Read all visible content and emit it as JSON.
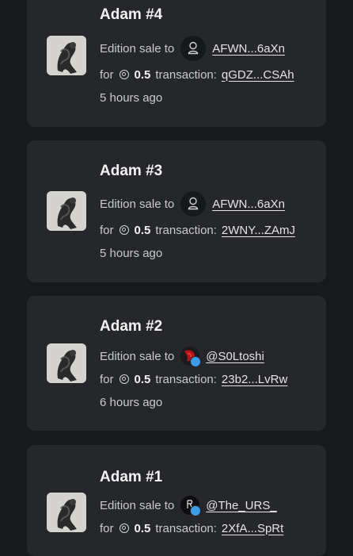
{
  "sales": [
    {
      "title": "Adam #4",
      "label": "Edition sale to",
      "buyer": "AFWN...6aXn",
      "buyer_type": "wallet",
      "for_label": "for",
      "price": "0.5",
      "tx_label": "transaction:",
      "tx": "qGDZ...CSAh",
      "time": "5 hours ago"
    },
    {
      "title": "Adam #3",
      "label": "Edition sale to",
      "buyer": "AFWN...6aXn",
      "buyer_type": "wallet",
      "for_label": "for",
      "price": "0.5",
      "tx_label": "transaction:",
      "tx": "2WNY...ZAmJ",
      "time": "5 hours ago"
    },
    {
      "title": "Adam #2",
      "label": "Edition sale to",
      "buyer": "@S0Ltoshi",
      "buyer_type": "twitter",
      "for_label": "for",
      "price": "0.5",
      "tx_label": "transaction:",
      "tx": "23b2...LvRw",
      "time": "6 hours ago"
    },
    {
      "title": "Adam #1",
      "label": "Edition sale to",
      "buyer": "@The_URS_",
      "buyer_type": "twitter",
      "for_label": "for",
      "price": "0.5",
      "tx_label": "transaction:",
      "tx": "2XfA...SpRt",
      "time": ""
    }
  ],
  "icons": {
    "currency": "coin-icon",
    "wallet_avatar": "user-outline-icon",
    "verified": "twitter-badge-icon"
  },
  "colors": {
    "background": "#18191c",
    "card": "#26272b",
    "badge": "#3b9ce8"
  }
}
